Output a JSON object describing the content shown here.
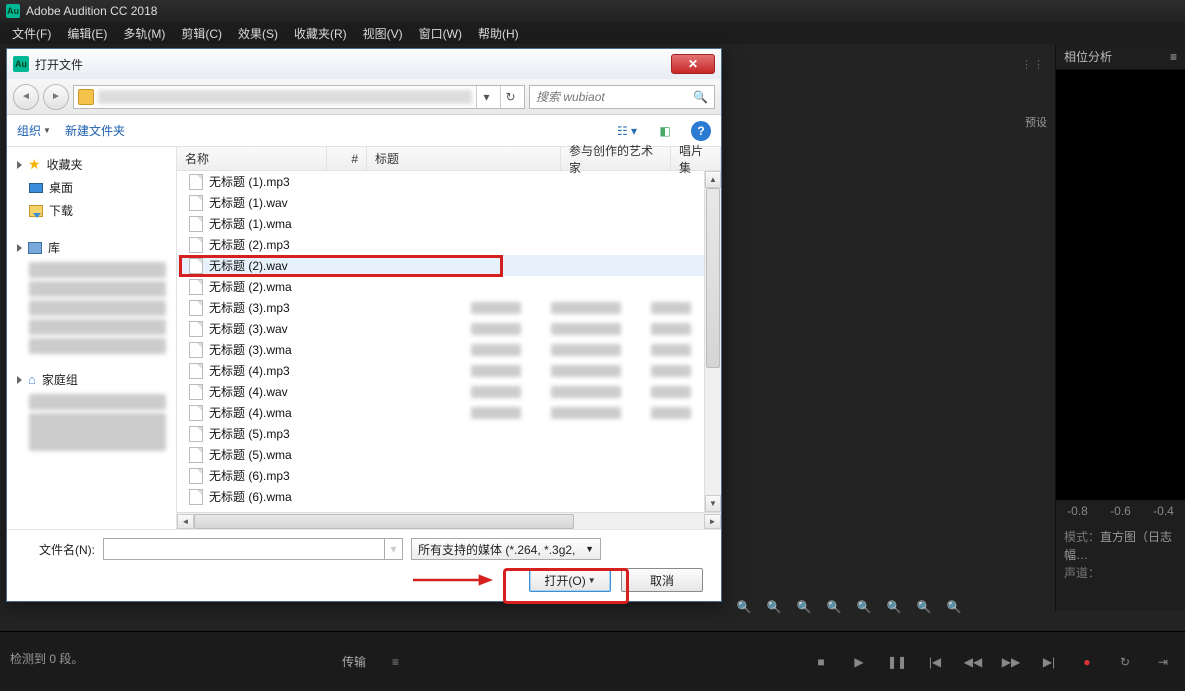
{
  "app": {
    "title": "Adobe Audition CC 2018"
  },
  "menu": [
    "文件(F)",
    "编辑(E)",
    "多轨(M)",
    "剪辑(C)",
    "效果(S)",
    "收藏夹(R)",
    "视图(V)",
    "窗口(W)",
    "帮助(H)"
  ],
  "right_panel": {
    "title": "相位分析",
    "preset_label": "预设",
    "axis_ticks": [
      "-0.8",
      "-0.6",
      "-0.4"
    ],
    "mode_label": "模式：",
    "mode_value": "直方图（日志幅…",
    "channel_label": "声道："
  },
  "transport": {
    "label": "传输"
  },
  "status": {
    "text": "检测到 0 段。"
  },
  "dialog": {
    "title": "打开文件",
    "search_placeholder": "搜索 wubiaot",
    "toolbar": {
      "organize": "组织",
      "new_folder": "新建文件夹"
    },
    "sidebar": {
      "favorites": "收藏夹",
      "desktop": "桌面",
      "downloads": "下载",
      "library": "库",
      "homegroup": "家庭组"
    },
    "columns": {
      "name": "名称",
      "num": "#",
      "title": "标题",
      "artist": "参与创作的艺术家",
      "album": "唱片集"
    },
    "files": [
      "无标题 (1).mp3",
      "无标题 (1).wav",
      "无标题 (1).wma",
      "无标题 (2).mp3",
      "无标题 (2).wav",
      "无标题 (2).wma",
      "无标题 (3).mp3",
      "无标题 (3).wav",
      "无标题 (3).wma",
      "无标题 (4).mp3",
      "无标题 (4).wav",
      "无标题 (4).wma",
      "无标题 (5).mp3",
      "无标题 (5).wma",
      "无标题 (6).mp3",
      "无标题 (6).wma"
    ],
    "selected_index": 4,
    "filename_label": "文件名(N):",
    "filename_value": "",
    "filter": "所有支持的媒体 (*.264, *.3g2,",
    "open_btn": "打开(O)",
    "cancel_btn": "取消"
  }
}
